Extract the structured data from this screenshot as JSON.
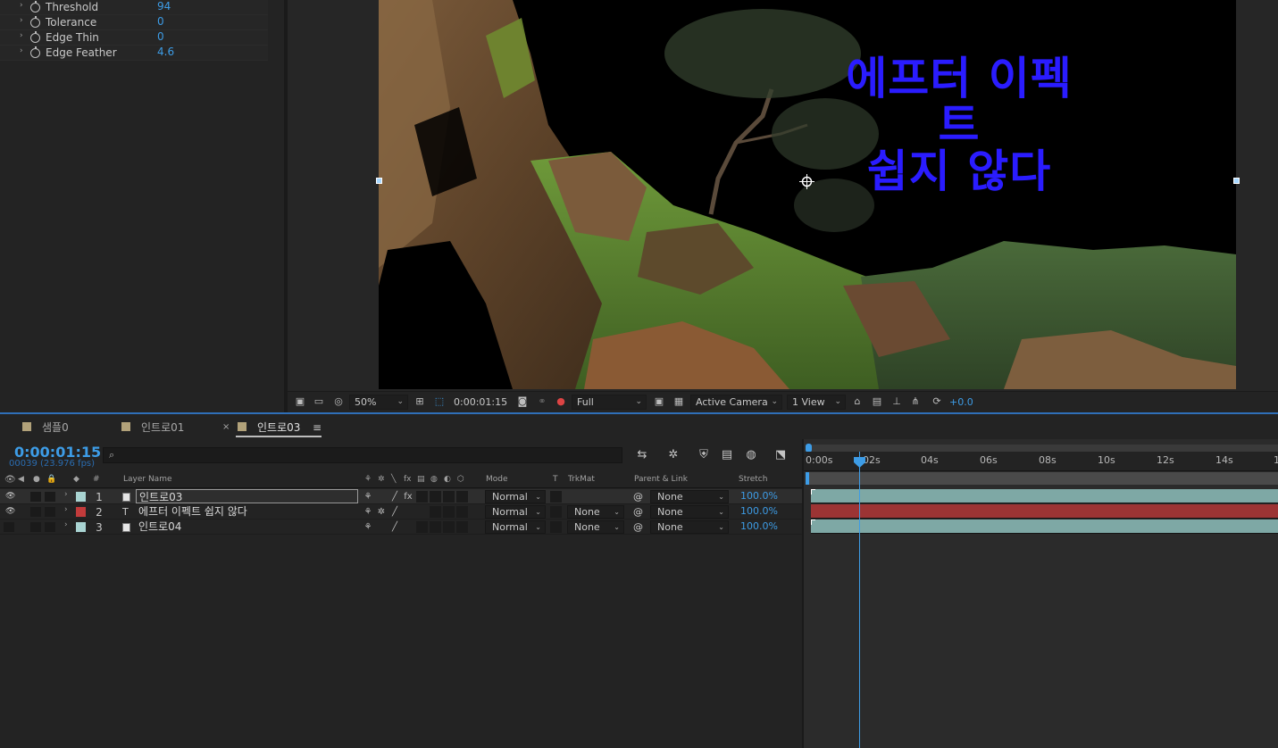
{
  "effect_controls": {
    "properties": [
      {
        "name": "Threshold",
        "value": "94"
      },
      {
        "name": "Tolerance",
        "value": "0"
      },
      {
        "name": "Edge Thin",
        "value": "0"
      },
      {
        "name": "Edge Feather",
        "value": "4.6"
      }
    ]
  },
  "viewer": {
    "comp_text_line1": "에프터 이펙트",
    "comp_text_line2": "쉽지 않다",
    "toolbar": {
      "magnification": "50%",
      "timecode": "0:00:01:15",
      "resolution": "Full",
      "camera": "Active Camera",
      "views": "1 View",
      "exposure": "+0.0"
    }
  },
  "tabs": [
    {
      "label": "샘플0",
      "active": false
    },
    {
      "label": "인트로01",
      "active": false
    },
    {
      "label": "인트로03",
      "active": true
    }
  ],
  "timeline": {
    "timecode": "0:00:01:15",
    "frames": "00039 (23.976 fps)",
    "search_placeholder": "",
    "columns": {
      "num": "#",
      "layer_name": "Layer Name",
      "mode": "Mode",
      "t": "T",
      "trkmat": "TrkMat",
      "parent_link": "Parent & Link",
      "stretch": "Stretch"
    },
    "layers": [
      {
        "num": "1",
        "name": "인트로03",
        "type": "footage",
        "label_color": "#a9d4d2",
        "mode": "Normal",
        "trkmat": "",
        "parent": "None",
        "stretch": "100.0%",
        "bar_color": "#7ea8a5"
      },
      {
        "num": "2",
        "name": "에프터 이펙트 쉽지 않다",
        "type": "text",
        "label_color": "#c23b3b",
        "mode": "Normal",
        "trkmat": "None",
        "parent": "None",
        "stretch": "100.0%",
        "bar_color": "#9c3434"
      },
      {
        "num": "3",
        "name": "인트로04",
        "type": "footage",
        "label_color": "#a9d4d2",
        "mode": "Normal",
        "trkmat": "None",
        "parent": "None",
        "stretch": "100.0%",
        "bar_color": "#7ea8a5"
      }
    ],
    "ruler_labels": [
      "0:00s",
      "02s",
      "04s",
      "06s",
      "08s",
      "10s",
      "12s",
      "14s",
      "1"
    ]
  },
  "colors": {
    "accent": "#3d9ce6",
    "comp_text": "#2a1cff"
  }
}
